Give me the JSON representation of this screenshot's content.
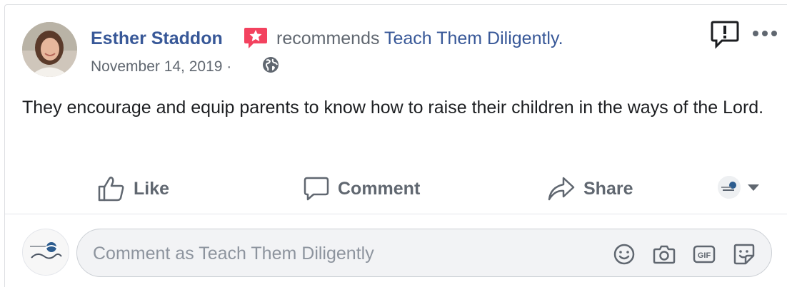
{
  "post": {
    "author": "Esther Staddon",
    "recommends_text": "recommends",
    "page_name": "Teach Them Diligently.",
    "date": "November 14, 2019 ·",
    "body": "They encourage and equip parents to know how to raise their children in the ways of the Lord."
  },
  "actions": {
    "like": "Like",
    "comment": "Comment",
    "share": "Share"
  },
  "comment_box": {
    "placeholder": "Comment as Teach Them Diligently"
  },
  "icons": {
    "author_avatar": "avatar",
    "recommendation_badge": "star-badge-icon",
    "audience": "globe-icon",
    "report": "report-icon",
    "more": "more-icon",
    "like": "thumbs-up-icon",
    "comment": "comment-bubble-icon",
    "share": "share-arrow-icon",
    "emoji": "smiley-icon",
    "camera": "camera-icon",
    "gif": "gif-icon",
    "sticker": "sticker-icon"
  },
  "colors": {
    "link": "#385898",
    "secondary_text": "#606770",
    "body_text": "#1c1e21",
    "badge": "#f3425f",
    "input_bg": "#f2f3f5"
  }
}
